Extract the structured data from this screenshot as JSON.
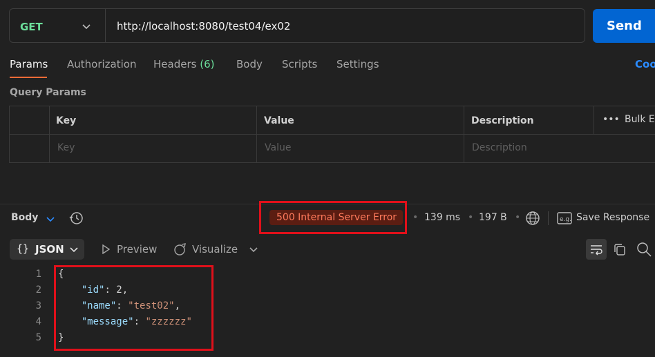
{
  "request": {
    "method": "GET",
    "url": "http://localhost:8080/test04/ex02",
    "send_label": "Send"
  },
  "tabs": [
    {
      "label": "Params"
    },
    {
      "label": "Authorization"
    },
    {
      "label": "Headers",
      "count": "(6)"
    },
    {
      "label": "Body"
    },
    {
      "label": "Scripts"
    },
    {
      "label": "Settings"
    }
  ],
  "cookies_label": "Coo",
  "query_params": {
    "title": "Query Params",
    "headers": {
      "key": "Key",
      "value": "Value",
      "description": "Description",
      "bulk_edit": "Bulk E"
    },
    "placeholders": {
      "key": "Key",
      "value": "Value",
      "description": "Description"
    }
  },
  "response": {
    "section_label": "Body",
    "status": "500 Internal Server Error",
    "time": "139 ms",
    "size": "197 B",
    "save_label": "Save Response",
    "format": "JSON",
    "preview_label": "Preview",
    "visualize_label": "Visualize",
    "line_numbers": [
      "1",
      "2",
      "3",
      "4",
      "5"
    ],
    "body": {
      "open": "{",
      "id_key": "\"id\"",
      "id_value": "2",
      "name_key": "\"name\"",
      "name_value": "\"test02\"",
      "message_key": "\"message\"",
      "message_value": "\"zzzzzz\"",
      "close": "}"
    }
  },
  "colors": {
    "accent_send": "#0265d2",
    "method_get": "#6bdd9a",
    "status_error": "#ff7a5c",
    "highlight_box": "#e0101a",
    "active_tab_underline": "#ff6c37"
  }
}
